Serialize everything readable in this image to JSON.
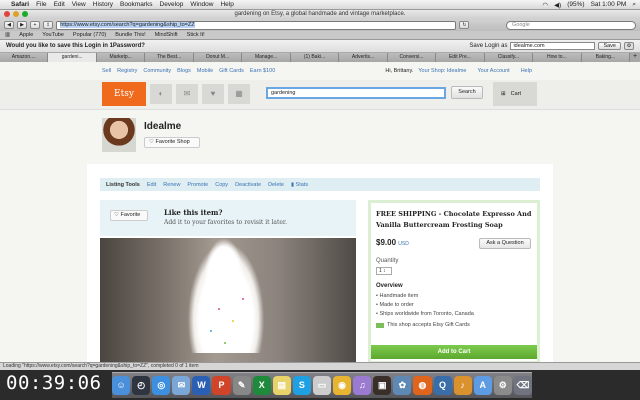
{
  "menubar": {
    "apple_glyph": "",
    "app": "Safari",
    "items": [
      "File",
      "Edit",
      "View",
      "History",
      "Bookmarks",
      "Develop",
      "Window",
      "Help"
    ],
    "battery": "(95%)",
    "clock": "Sat 1:00 PM"
  },
  "window": {
    "title": "gardening on Etsy, a global handmade and vintage marketplace."
  },
  "toolbar": {
    "url": "https://www.etsy.com/search?q=gardening&ship_to=ZZ",
    "search_placeholder": "Google"
  },
  "bookmarks": [
    "Apple",
    "YouTube",
    "Popular (770)",
    "Bundle This!",
    "MindShift",
    "Stick It!"
  ],
  "password_bar": {
    "prompt": "Would you like to save this Login in 1Password?",
    "save_as_label": "Save Login as",
    "save_as_value": "idealme.com",
    "save_button": "Save"
  },
  "tabs": [
    "Amazon....",
    "gardeni...",
    "Marketp...",
    "The Best...",
    "Donut M...",
    "Manage...",
    "(1) Baki...",
    "Advertis...",
    "Conversi...",
    "Edit Pre...",
    "Classify...",
    "How to...",
    "Baking..."
  ],
  "site_nav": {
    "links": [
      "Sell",
      "Registry",
      "Community",
      "Blogs",
      "Mobile",
      "Gift Cards",
      "Earn $100"
    ],
    "greeting": "Hi, Brittany.",
    "account_links": [
      "Your Shop: Idealme",
      "Your Account",
      "Help"
    ]
  },
  "header": {
    "logo": "Etsy",
    "search_value": "gardening",
    "search_button": "Search",
    "cart_label": "Cart"
  },
  "shop": {
    "name": "Idealme",
    "favorite_label": "Favorite Shop"
  },
  "listing_tools": {
    "label": "Listing Tools",
    "links": [
      "Edit",
      "Renew",
      "Promote",
      "Copy",
      "Deactivate",
      "Delete",
      "Stats"
    ]
  },
  "like_box": {
    "favorite_label": "Favorite",
    "heading": "Like this item?",
    "sub": "Add it to your favorites to revisit it later."
  },
  "item": {
    "title": "FREE SHIPPING - Chocolate Expresso And Vanilla Buttercream Frosting Soap",
    "price": "$9.00",
    "currency": "USD",
    "ask_button": "Ask a Question",
    "quantity_label": "Quantity",
    "quantity_value": "1",
    "overview_label": "Overview",
    "overview": [
      "Handmade item",
      "Made to order",
      "Ships worldwide from Toronto, Canada"
    ],
    "gift_card_note": "This shop accepts Etsy Gift Cards",
    "add_to_cart": "Add to Cart"
  },
  "status_bar": "Loading \"https://www.etsy.com/search?q=gardening&ship_to=ZZ\", completed 0 of 1 item",
  "timer": "00:39:06",
  "dock": {
    "icons": [
      {
        "name": "finder-icon",
        "color": "#4a8fd9",
        "glyph": "☺"
      },
      {
        "name": "dashboard-icon",
        "color": "#2e3440",
        "glyph": "◴"
      },
      {
        "name": "safari-icon",
        "color": "#3d8fe0",
        "glyph": "◎"
      },
      {
        "name": "mail-icon",
        "color": "#7aa7d8",
        "glyph": "✉"
      },
      {
        "name": "word-icon",
        "color": "#2b5fb4",
        "glyph": "W"
      },
      {
        "name": "powerpoint-icon",
        "color": "#d0442a",
        "glyph": "P"
      },
      {
        "name": "script-icon",
        "color": "#888888",
        "glyph": "✎"
      },
      {
        "name": "excel-icon",
        "color": "#1f8a3c",
        "glyph": "X"
      },
      {
        "name": "stickies-icon",
        "color": "#e8d36a",
        "glyph": "▤"
      },
      {
        "name": "skype-icon",
        "color": "#1fa0e3",
        "glyph": "S"
      },
      {
        "name": "notes-icon",
        "color": "#cccccc",
        "glyph": "▭"
      },
      {
        "name": "chrome-icon",
        "color": "#e7b531",
        "glyph": "◉"
      },
      {
        "name": "itunes-icon",
        "color": "#9a7bd1",
        "glyph": "♫"
      },
      {
        "name": "photo-booth-icon",
        "color": "#3a2e2a",
        "glyph": "▣"
      },
      {
        "name": "iphoto-icon",
        "color": "#5e89b5",
        "glyph": "✿"
      },
      {
        "name": "firefox-icon",
        "color": "#e0641c",
        "glyph": "◍"
      },
      {
        "name": "quicktime-icon",
        "color": "#3a6ea8",
        "glyph": "Q"
      },
      {
        "name": "garageband-icon",
        "color": "#d9922e",
        "glyph": "♪"
      },
      {
        "name": "app-store-icon",
        "color": "#5d9be3",
        "glyph": "A"
      },
      {
        "name": "system-preferences-icon",
        "color": "#8b8b8b",
        "glyph": "⚙"
      },
      {
        "name": "trash-icon",
        "color": "#6f7480",
        "glyph": "⌫"
      }
    ]
  },
  "colors": {
    "etsy_orange": "#f06a1e",
    "link_blue": "#3a73b5",
    "cart_green": "#5ca82f",
    "search_focus": "#6aa6e4"
  }
}
